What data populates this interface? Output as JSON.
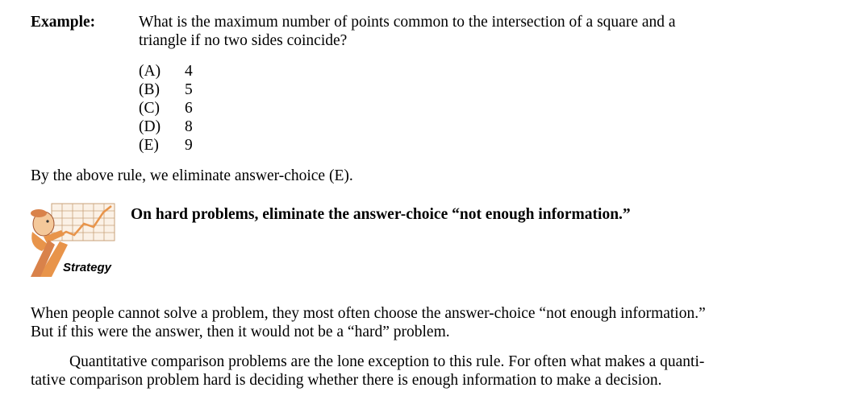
{
  "example": {
    "label": "Example:",
    "question_line1": "What is the maximum number of points common to the intersection of a square and a",
    "question_line2": "triangle if no two sides coincide?",
    "choices": [
      {
        "letter": "(A)",
        "value": "4"
      },
      {
        "letter": "(B)",
        "value": "5"
      },
      {
        "letter": "(C)",
        "value": "6"
      },
      {
        "letter": "(D)",
        "value": "8"
      },
      {
        "letter": "(E)",
        "value": "9"
      }
    ]
  },
  "rule_text": "By the above rule, we eliminate answer-choice (E).",
  "strategy": {
    "heading": "On hard problems, eliminate the answer-choice “not enough information.”",
    "icon_label": "Strategy"
  },
  "paragraph1": {
    "line1": "When people cannot solve a problem, they most often choose the answer-choice “not enough information.”",
    "line2": "But if this were the answer, then it would not be a “hard” problem."
  },
  "paragraph2": {
    "line1": "Quantitative comparison problems are the lone exception to this rule.  For often what makes a quanti-",
    "line2": "tative comparison problem hard is deciding whether there is enough information to make a decision."
  },
  "colors": {
    "text": "#000000",
    "icon_orange": "#e8944a",
    "icon_skin": "#f4c89a",
    "grid": "#c9a27a"
  }
}
